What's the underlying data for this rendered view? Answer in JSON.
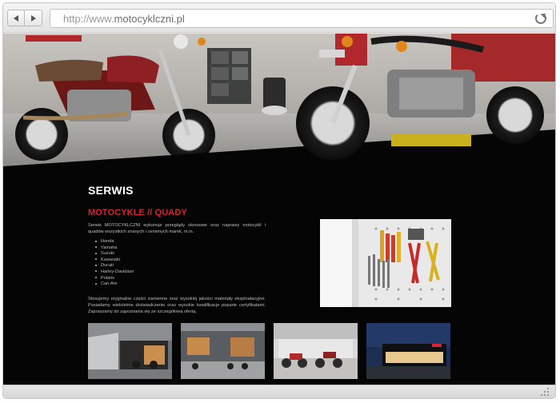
{
  "browser": {
    "url_prefix": "http://www.",
    "url_domain": "motocyklczni.pl"
  },
  "page": {
    "section_title": "SERWIS",
    "subtitle": "MOTOCYKLE // QUADY",
    "intro": "Serwis MOTOCYKLCZNI wykonuje przeglądy okresowe oraz naprawy motocykli i quadów wszystkich znanych i cenionych marek, m.in.",
    "brands": [
      "Honda",
      "Yamaha",
      "Suzuki",
      "Kawasaki",
      "Ducati",
      "Harley-Davidson",
      "Polaris",
      "Can-Am"
    ],
    "outro": "Stosujemy oryginalne części zamienne oraz wysokiej jakości materiały eksploatacyjne. Posiadamy wieloletnie doświadczenie oraz wysokie kwalifikacje poparte certyfikatami. Zapraszamy do zapoznania się ze szczegółową ofertą."
  },
  "icons": {
    "back": "arrow-left-icon",
    "forward": "arrow-right-icon",
    "reload": "reload-icon",
    "resize": "resize-grip-icon"
  },
  "colors": {
    "accent": "#d8242c",
    "background": "#050505",
    "text": "#bdbdbd"
  }
}
